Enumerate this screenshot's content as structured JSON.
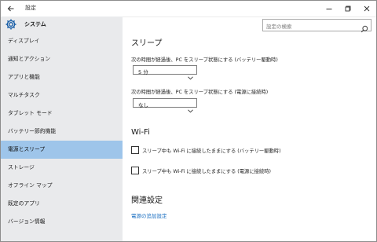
{
  "window": {
    "title": "設定",
    "back_icon": "back-arrow-icon",
    "controls": [
      "minimize-icon",
      "maximize-icon",
      "close-icon"
    ]
  },
  "sidebar": {
    "header": "システム",
    "header_icon": "gear-icon",
    "items": [
      {
        "label": "ディスプレイ",
        "active": false
      },
      {
        "label": "通知とアクション",
        "active": false
      },
      {
        "label": "アプリと機能",
        "active": false
      },
      {
        "label": "マルチタスク",
        "active": false
      },
      {
        "label": "タブレット モード",
        "active": false
      },
      {
        "label": "バッテリー節約機能",
        "active": false
      },
      {
        "label": "電源とスリープ",
        "active": true
      },
      {
        "label": "ストレージ",
        "active": false
      },
      {
        "label": "オフライン マップ",
        "active": false
      },
      {
        "label": "既定のアプリ",
        "active": false
      },
      {
        "label": "バージョン情報",
        "active": false
      }
    ]
  },
  "search": {
    "placeholder": "設定の検索",
    "icon": "search-icon"
  },
  "content": {
    "sleep": {
      "heading": "スリープ",
      "battery_label": "次の時間が経過後、PC をスリープ状態にする (バッテリー駆動時)",
      "battery_value": "5 分",
      "power_label": "次の時間が経過後、PC をスリープ状態にする (電源に接続時)",
      "power_value": "なし"
    },
    "wifi": {
      "heading": "Wi-Fi",
      "battery_checkbox": "スリープ中も Wi-Fi に接続したままにする (バッテリー駆動時)",
      "battery_checked": false,
      "power_checkbox": "スリープ中も Wi-Fi に接続したままにする (電源に接続時)",
      "power_checked": false
    },
    "related": {
      "heading": "関連設定",
      "link": "電源の追加設定"
    }
  },
  "colors": {
    "accent_active": "#9ec5ea",
    "sidebar_bg": "#e9eaec",
    "link": "#1a6fc2"
  }
}
